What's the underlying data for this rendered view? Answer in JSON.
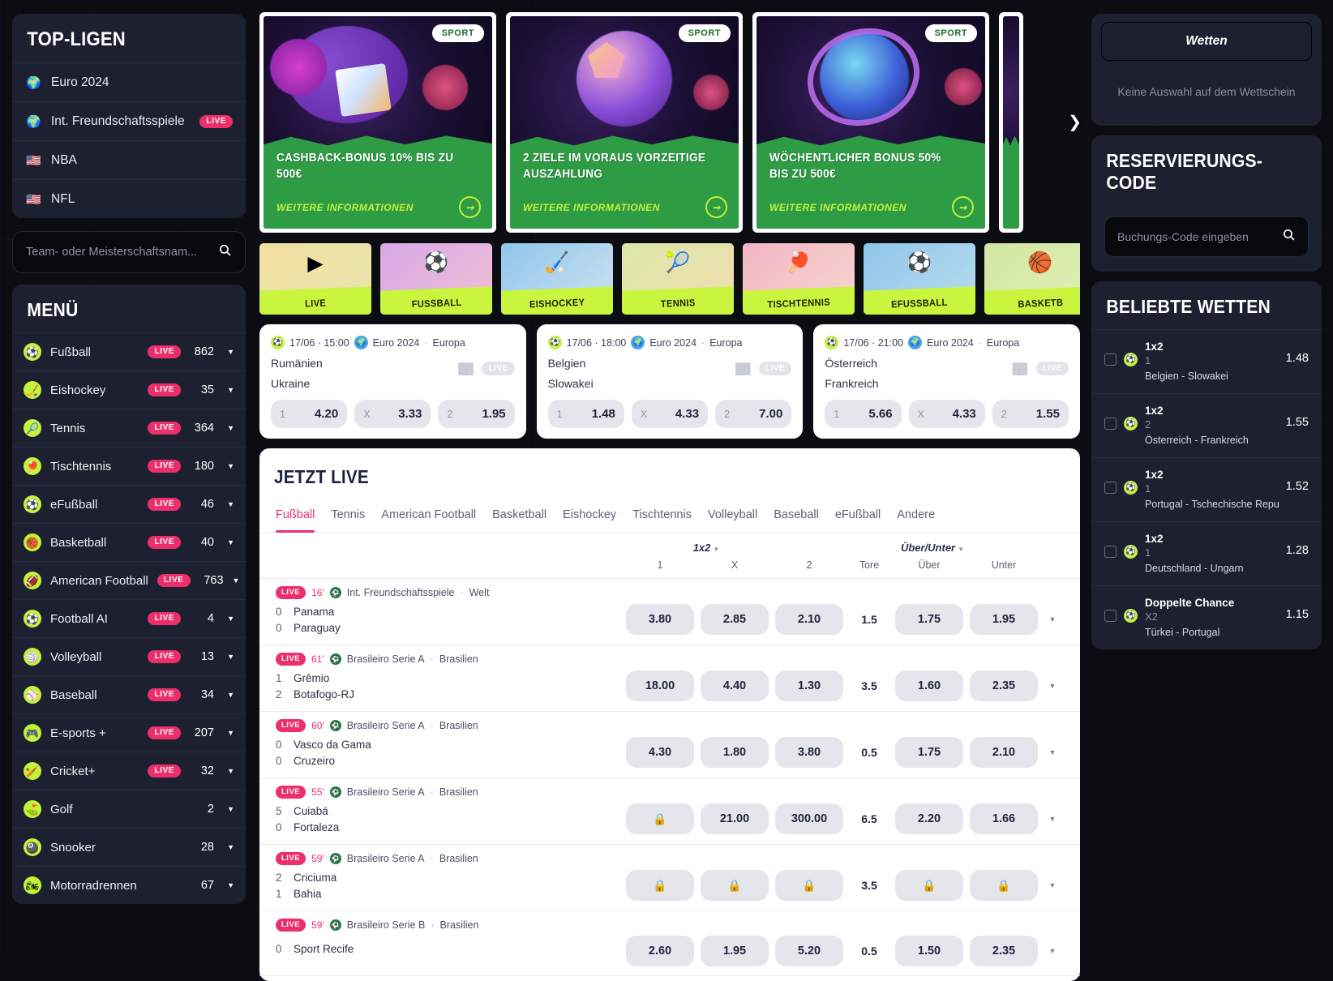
{
  "sidebar": {
    "top_leagues": {
      "title": "TOP-LIGEN",
      "items": [
        {
          "icon": "globe-icon",
          "glyph": "🌍",
          "label": "Euro 2024",
          "live": ""
        },
        {
          "icon": "globe-icon",
          "glyph": "🌍",
          "label": "Int. Freundschaftsspiele",
          "live": "LIVE"
        },
        {
          "icon": "flag-usa-icon",
          "glyph": "🇺🇸",
          "label": "NBA",
          "live": ""
        },
        {
          "icon": "flag-usa-icon",
          "glyph": "🇺🇸",
          "label": "NFL",
          "live": ""
        }
      ]
    },
    "search": {
      "placeholder": "Team- oder Meisterschaftsnam...",
      "icon": "search-icon"
    },
    "menu": {
      "title": "MENÜ",
      "items": [
        {
          "icon": "soccer-ball-icon",
          "glyph": "⚽",
          "label": "Fußball",
          "live": "LIVE",
          "count": "862"
        },
        {
          "icon": "hockey-icon",
          "glyph": "🏒",
          "label": "Eishockey",
          "live": "LIVE",
          "count": "35"
        },
        {
          "icon": "tennis-ball-icon",
          "glyph": "🎾",
          "label": "Tennis",
          "live": "LIVE",
          "count": "364"
        },
        {
          "icon": "table-tennis-icon",
          "glyph": "🏓",
          "label": "Tischtennis",
          "live": "LIVE",
          "count": "180"
        },
        {
          "icon": "soccer-ball-icon",
          "glyph": "⚽",
          "label": "eFußball",
          "live": "LIVE",
          "count": "46"
        },
        {
          "icon": "basketball-icon",
          "glyph": "🏀",
          "label": "Basketball",
          "live": "LIVE",
          "count": "40"
        },
        {
          "icon": "american-football-icon",
          "glyph": "🏈",
          "label": "American Football",
          "live": "LIVE",
          "count": "763"
        },
        {
          "icon": "soccer-ball-icon",
          "glyph": "⚽",
          "label": "Football AI",
          "live": "LIVE",
          "count": "4"
        },
        {
          "icon": "volleyball-icon",
          "glyph": "🏐",
          "label": "Volleyball",
          "live": "LIVE",
          "count": "13"
        },
        {
          "icon": "baseball-icon",
          "glyph": "⚾",
          "label": "Baseball",
          "live": "LIVE",
          "count": "34"
        },
        {
          "icon": "gamepad-icon",
          "glyph": "🎮",
          "label": "E-sports +",
          "live": "LIVE",
          "count": "207"
        },
        {
          "icon": "cricket-icon",
          "glyph": "🏏",
          "label": "Cricket+",
          "live": "LIVE",
          "count": "32"
        },
        {
          "icon": "golf-icon",
          "glyph": "⛳",
          "label": "Golf",
          "live": "",
          "count": "2"
        },
        {
          "icon": "snooker-icon",
          "glyph": "🎱",
          "label": "Snooker",
          "live": "",
          "count": "28"
        },
        {
          "icon": "motorcycle-icon",
          "glyph": "🏍",
          "label": "Motorradrennen",
          "live": "",
          "count": "67"
        }
      ]
    }
  },
  "promos": {
    "next_icon": "chevron-right-icon",
    "items": [
      {
        "badge": "SPORT",
        "title": "CASHBACK-BONUS 10% BIS ZU 500€",
        "cta": "WEITERE INFORMATIONEN",
        "art": "gift-box"
      },
      {
        "badge": "SPORT",
        "title": "2 ZIELE IM VORAUS VORZEITIGE AUSZAHLUNG",
        "cta": "WEITERE INFORMATIONEN",
        "art": "soccer-ball"
      },
      {
        "badge": "SPORT",
        "title": "WÖCHENTLICHER BONUS 50% BIS ZU 500€",
        "cta": "WEITERE INFORMATIONEN",
        "art": "ring-ball"
      }
    ]
  },
  "categories": [
    {
      "label": "LIVE",
      "icon": "live-play-icon",
      "glyph": "▶",
      "c1": "#f3dfa0",
      "c2": "#e8e6ae"
    },
    {
      "label": "FUSSBALL",
      "icon": "soccer-ball-icon",
      "glyph": "⚽",
      "c1": "#d7a8e8",
      "c2": "#f1c0d4"
    },
    {
      "label": "EISHOCKEY",
      "icon": "hockey-sticks-icon",
      "glyph": "🏑",
      "c1": "#8fc6ea",
      "c2": "#cfe3f2"
    },
    {
      "label": "TENNIS",
      "icon": "tennis-ball-icon",
      "glyph": "🎾",
      "c1": "#dbe7a8",
      "c2": "#f3ddb0"
    },
    {
      "label": "TISCHTENNIS",
      "icon": "table-tennis-icon",
      "glyph": "🏓",
      "c1": "#f2b5c4",
      "c2": "#f6d7d0"
    },
    {
      "label": "EFUSSBALL",
      "icon": "soccer-ball-icon",
      "glyph": "⚽",
      "c1": "#8fc6ea",
      "c2": "#b9dcf0"
    },
    {
      "label": "BASKETB",
      "icon": "basketball-icon",
      "glyph": "🏀",
      "c1": "#cfe7a0",
      "c2": "#e4f0b8"
    }
  ],
  "match_cards": [
    {
      "date": "17/06 · 15:00",
      "league": "Euro 2024",
      "region": "Europa",
      "home": "Rumänien",
      "away": "Ukraine",
      "live_badge": "LIVE",
      "odds": [
        {
          "k": "1",
          "v": "4.20"
        },
        {
          "k": "X",
          "v": "3.33"
        },
        {
          "k": "2",
          "v": "1.95"
        }
      ]
    },
    {
      "date": "17/06 · 18:00",
      "league": "Euro 2024",
      "region": "Europa",
      "home": "Belgien",
      "away": "Slowakei",
      "live_badge": "LIVE",
      "odds": [
        {
          "k": "1",
          "v": "1.48"
        },
        {
          "k": "X",
          "v": "4.33"
        },
        {
          "k": "2",
          "v": "7.00"
        }
      ]
    },
    {
      "date": "17/06 · 21:00",
      "league": "Euro 2024",
      "region": "Europa",
      "home": "Österreich",
      "away": "Frankreich",
      "live_badge": "LIVE",
      "odds": [
        {
          "k": "1",
          "v": "5.66"
        },
        {
          "k": "X",
          "v": "4.33"
        },
        {
          "k": "2",
          "v": "1.55"
        }
      ]
    }
  ],
  "live_section": {
    "title": "JETZT LIVE",
    "tabs": [
      {
        "label": "Fußball",
        "active": true
      },
      {
        "label": "Tennis",
        "active": false
      },
      {
        "label": "American Football",
        "active": false
      },
      {
        "label": "Basketball",
        "active": false
      },
      {
        "label": "Eishockey",
        "active": false
      },
      {
        "label": "Tischtennis",
        "active": false
      },
      {
        "label": "Volleyball",
        "active": false
      },
      {
        "label": "Baseball",
        "active": false
      },
      {
        "label": "eFußball",
        "active": false
      },
      {
        "label": "Andere",
        "active": false
      }
    ],
    "group_1x2": "1x2",
    "group_ou": "Über/Unter",
    "columns": {
      "c1": "1",
      "cx": "X",
      "c2": "2",
      "tore": "Tore",
      "ueber": "Über",
      "unter": "Unter"
    },
    "rows": [
      {
        "live": "LIVE",
        "minute": "16'",
        "league": "Int. Freundschaftsspiele",
        "region": "Welt",
        "home_score": "0",
        "home": "Panama",
        "away_score": "0",
        "away": "Paraguay",
        "o1": "3.80",
        "ox": "2.85",
        "o2": "2.10",
        "tore": "1.5",
        "ou": "1.75",
        "ounder": "1.95"
      },
      {
        "live": "LIVE",
        "minute": "61'",
        "league": "Brasileiro Serie A",
        "region": "Brasilien",
        "home_score": "1",
        "home": "Grêmio",
        "away_score": "2",
        "away": "Botafogo-RJ",
        "o1": "18.00",
        "ox": "4.40",
        "o2": "1.30",
        "tore": "3.5",
        "ou": "1.60",
        "ounder": "2.35"
      },
      {
        "live": "LIVE",
        "minute": "60'",
        "league": "Brasileiro Serie A",
        "region": "Brasilien",
        "home_score": "0",
        "home": "Vasco da Gama",
        "away_score": "0",
        "away": "Cruzeiro",
        "o1": "4.30",
        "ox": "1.80",
        "o2": "3.80",
        "tore": "0.5",
        "ou": "1.75",
        "ounder": "2.10"
      },
      {
        "live": "LIVE",
        "minute": "55'",
        "league": "Brasileiro Serie A",
        "region": "Brasilien",
        "home_score": "5",
        "home": "Cuiabá",
        "away_score": "0",
        "away": "Fortaleza",
        "o1": "🔒",
        "ox": "21.00",
        "o2": "300.00",
        "tore": "6.5",
        "ou": "2.20",
        "ounder": "1.66"
      },
      {
        "live": "LIVE",
        "minute": "59'",
        "league": "Brasileiro Serie A",
        "region": "Brasilien",
        "home_score": "2",
        "home": "Criciuma",
        "away_score": "1",
        "away": "Bahia",
        "o1": "🔒",
        "ox": "🔒",
        "o2": "🔒",
        "tore": "3.5",
        "ou": "🔒",
        "ounder": "🔒"
      },
      {
        "live": "LIVE",
        "minute": "59'",
        "league": "Brasileiro Serie B",
        "region": "Brasilien",
        "home_score": "0",
        "home": "Sport Recife",
        "away_score": "",
        "away": "",
        "o1": "2.60",
        "ox": "1.95",
        "o2": "5.20",
        "tore": "0.5",
        "ou": "1.50",
        "ounder": "2.35"
      }
    ]
  },
  "right": {
    "betslip_label": "Wetten",
    "empty_text": "Keine Auswahl auf dem Wettschein",
    "reservation": {
      "title": "RESERVIERUNGS-CODE",
      "placeholder": "Buchungs-Code eingeben",
      "icon": "search-icon"
    },
    "popular": {
      "title": "BELIEBTE WETTEN",
      "items": [
        {
          "type": "1x2",
          "pick": "1",
          "match": "Belgien  -  Slowakei",
          "odd": "1.48"
        },
        {
          "type": "1x2",
          "pick": "2",
          "match": "Österreich  -  Frankreich",
          "odd": "1.55"
        },
        {
          "type": "1x2",
          "pick": "1",
          "match": "Portugal  -  Tschechische Republik",
          "odd": "1.52"
        },
        {
          "type": "1x2",
          "pick": "1",
          "match": "Deutschland  -  Ungarn",
          "odd": "1.28"
        },
        {
          "type": "Doppelte Chance",
          "pick": "X2",
          "match": "Türkei  -  Portugal",
          "odd": "1.15"
        }
      ]
    }
  },
  "colors": {
    "accent_pink": "#ec2f6b",
    "accent_lime": "#c3f23c",
    "panel_bg": "#1c2030",
    "page_bg": "#0b0d12",
    "green_banner": "#2e9b45"
  }
}
